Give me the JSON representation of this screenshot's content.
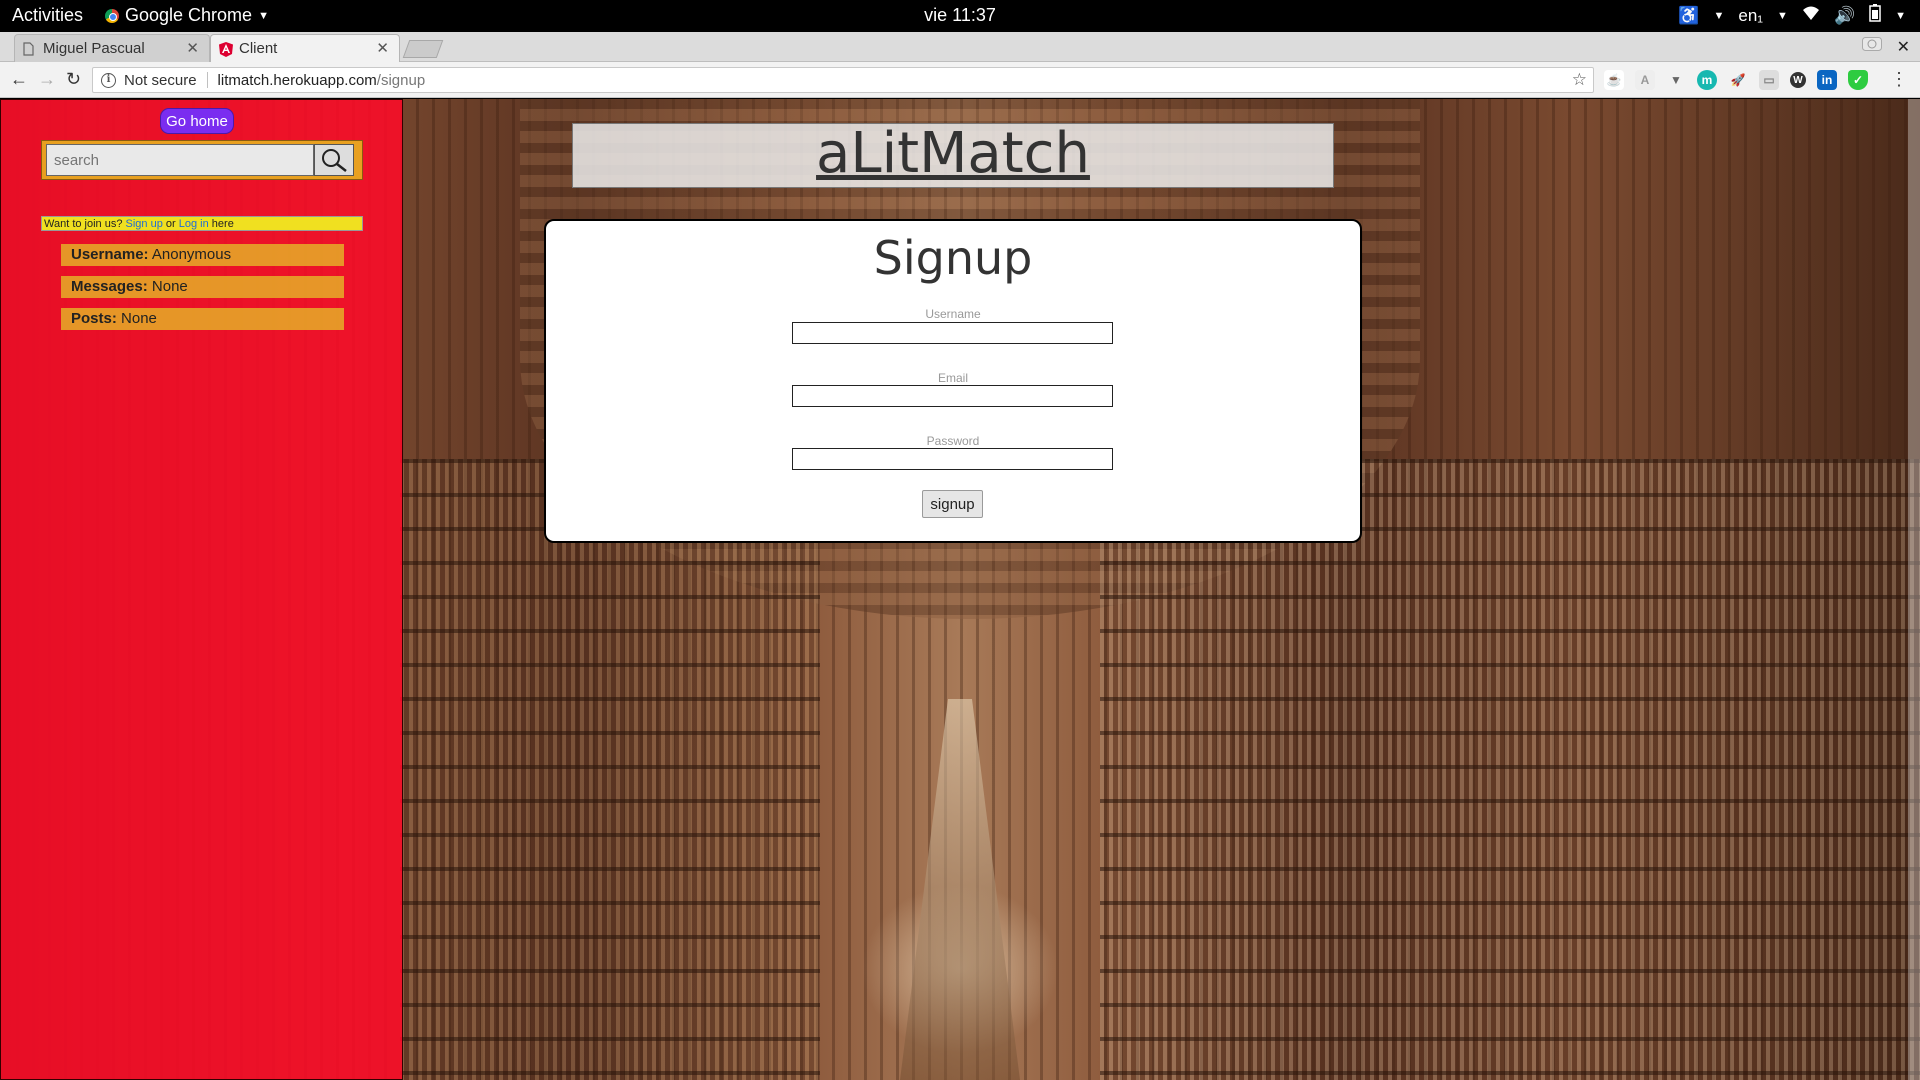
{
  "system_bar": {
    "activities": "Activities",
    "app_name": "Google Chrome",
    "clock": "vie 11:37",
    "keyboard_layout": "en₁"
  },
  "browser": {
    "tabs": [
      {
        "title": "Miguel Pascual",
        "active": false
      },
      {
        "title": "Client",
        "active": true
      }
    ],
    "security_label": "Not secure",
    "url_host": "litmatch.herokuapp.com",
    "url_path": "/signup"
  },
  "sidebar": {
    "home_button": "Go home",
    "search_placeholder": "search",
    "join_prefix": "Want to join us?",
    "signup_link": "Sign up",
    "join_or": "or",
    "login_link": "Log in",
    "join_suffix": "here",
    "info": [
      {
        "label": "Username:",
        "value": "Anonymous"
      },
      {
        "label": "Messages:",
        "value": "None"
      },
      {
        "label": "Posts:",
        "value": "None"
      }
    ]
  },
  "main": {
    "site_title": "aLitMatch",
    "form_title": "Signup",
    "fields": {
      "username": "Username",
      "email": "Email",
      "password": "Password"
    },
    "submit_label": "signup"
  },
  "colors": {
    "sidebar_bg": "#ff0a28",
    "home_button_bg": "#7a2df0",
    "search_frame": "#e8a020",
    "join_bar": "#f0e020",
    "info_row_bg": "#e6a528",
    "link": "#1f6cd8"
  }
}
